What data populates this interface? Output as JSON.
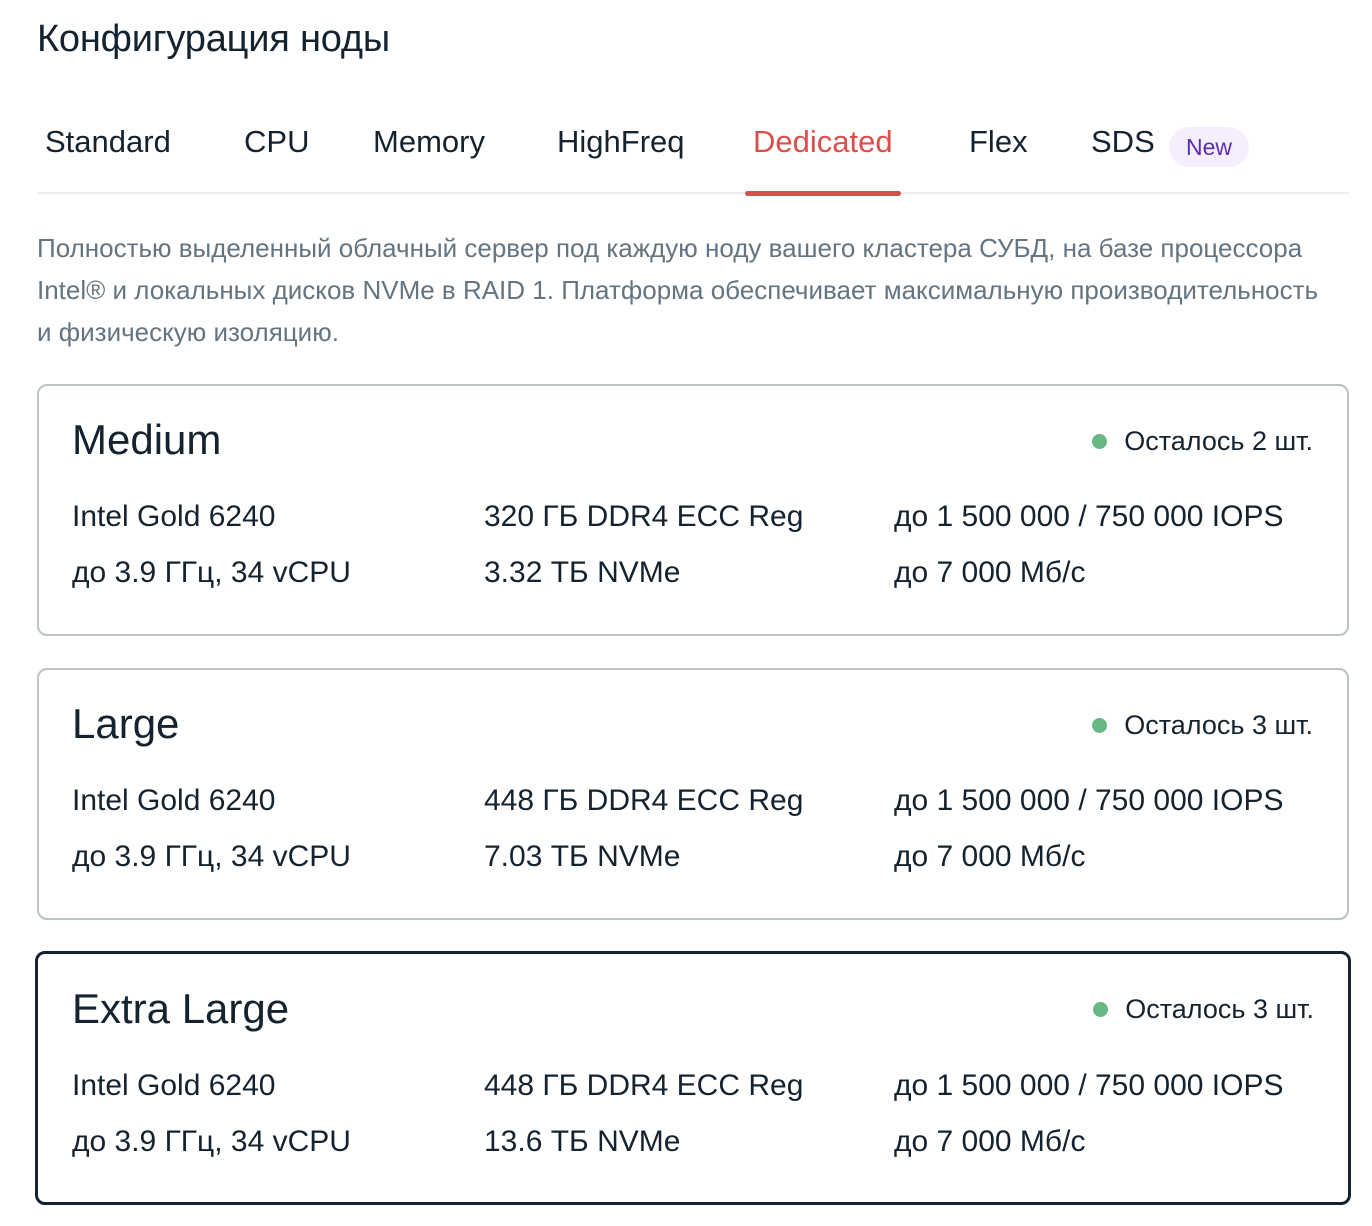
{
  "page_title": "Конфигурация ноды",
  "tabs": [
    {
      "label": "Standard",
      "active": false
    },
    {
      "label": "CPU",
      "active": false
    },
    {
      "label": "Memory",
      "active": false
    },
    {
      "label": "HighFreq",
      "active": false
    },
    {
      "label": "Dedicated",
      "active": true
    },
    {
      "label": "Flex",
      "active": false
    },
    {
      "label": "SDS",
      "active": false,
      "badge": "New"
    }
  ],
  "description": "Полностью выделенный облачный сервер под каждую ноду вашего кластера СУБД, на базе процессора Intel® и локальных дисков NVMe в RAID 1. Платформа обеспечивает максимальную производительность и физическую изоляцию.",
  "colors": {
    "accent": "#db4f4b",
    "text": "#14232f",
    "muted_text": "#647480",
    "stock_dot": "#67b886",
    "badge_bg": "#f4eefe",
    "badge_text": "#5b2fb0"
  },
  "plans": [
    {
      "name": "Medium",
      "stock": "Осталось 2 шт.",
      "cpu_model": "Intel Gold 6240",
      "cpu_details": "до 3.9 ГГц, 34 vCPU",
      "memory": "320 ГБ DDR4 ECC Reg",
      "storage": "3.32 ТБ NVMe",
      "iops": "до 1 500 000 / 750 000 IOPS",
      "throughput": "до 7 000 Мб/с",
      "selected": false
    },
    {
      "name": "Large",
      "stock": "Осталось 3 шт.",
      "cpu_model": "Intel Gold 6240",
      "cpu_details": "до 3.9 ГГц, 34 vCPU",
      "memory": "448 ГБ DDR4 ECC Reg",
      "storage": "7.03 ТБ NVMe",
      "iops": "до 1 500 000 / 750 000 IOPS",
      "throughput": "до 7 000 Мб/с",
      "selected": false
    },
    {
      "name": "Extra Large",
      "stock": "Осталось 3 шт.",
      "cpu_model": "Intel Gold 6240",
      "cpu_details": "до 3.9 ГГц, 34 vCPU",
      "memory": "448 ГБ DDR4 ECC Reg",
      "storage": "13.6 ТБ NVMe",
      "iops": "до 1 500 000 / 750 000 IOPS",
      "throughput": "до 7 000 Мб/с",
      "selected": true
    }
  ]
}
